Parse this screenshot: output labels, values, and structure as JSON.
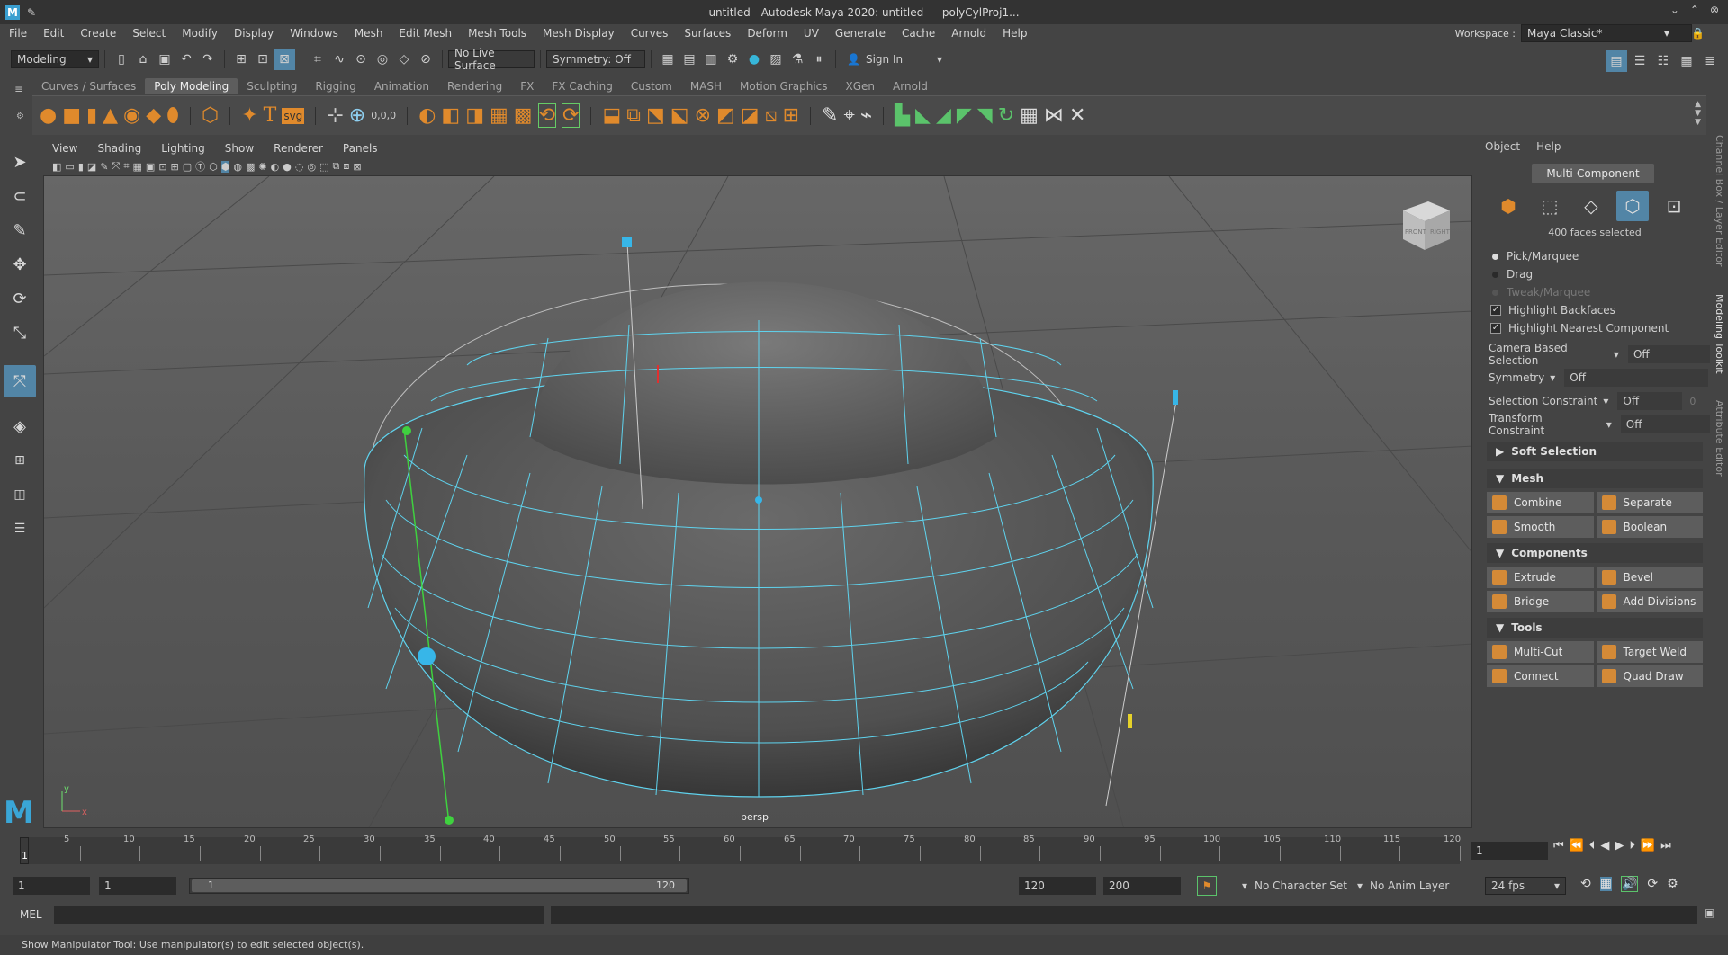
{
  "window": {
    "title": "untitled - Autodesk Maya 2020: untitled  ---  polyCylProj1...",
    "app_logo": "M"
  },
  "menubar": [
    "File",
    "Edit",
    "Create",
    "Select",
    "Modify",
    "Display",
    "Windows",
    "Mesh",
    "Edit Mesh",
    "Mesh Tools",
    "Mesh Display",
    "Curves",
    "Surfaces",
    "Deform",
    "UV",
    "Generate",
    "Cache",
    "Arnold",
    "Help"
  ],
  "workspace": {
    "label": "Workspace :",
    "value": "Maya Classic*"
  },
  "statusline": {
    "mode": "Modeling",
    "live_surface": "No Live Surface",
    "symmetry": "Symmetry: Off",
    "sign_in": "Sign In"
  },
  "shelf_tabs": [
    "Curves / Surfaces",
    "Poly Modeling",
    "Sculpting",
    "Rigging",
    "Animation",
    "Rendering",
    "FX",
    "FX Caching",
    "Custom",
    "MASH",
    "Motion Graphics",
    "XGen",
    "Arnold"
  ],
  "shelf_active": "Poly Modeling",
  "shelf_icons": [
    "sphere-icon",
    "cube-icon",
    "cylinder-icon",
    "cone-icon",
    "torus-icon",
    "plane-icon",
    "disc-icon",
    "platonic-icon",
    "star-icon",
    "text-icon",
    "svg-icon",
    "combine-icon",
    "separate-icon",
    "smooth-icon",
    "boolean-icon",
    "extrude-icon",
    "bevel-icon",
    "bridge-icon"
  ],
  "shelf_text_icons": {
    "text": "T",
    "svg": "svg",
    "coords": "0,0,0"
  },
  "panel_menu": [
    "View",
    "Shading",
    "Lighting",
    "Show",
    "Renderer",
    "Panels"
  ],
  "viewport": {
    "camera": "persp",
    "viewcube_front": "FRONT",
    "viewcube_right": "RIGHT",
    "axis_y": "y",
    "axis_x": "x"
  },
  "modeling_toolkit": {
    "tabs": [
      "Object",
      "Help"
    ],
    "multi_component": "Multi-Component",
    "selection_count": "400 faces selected",
    "modes": [
      "Pick/Marquee",
      "Drag",
      "Tweak/Marquee"
    ],
    "checks": [
      "Highlight Backfaces",
      "Highlight Nearest Component"
    ],
    "props": [
      {
        "label": "Camera Based Selection",
        "value": "Off"
      },
      {
        "label": "Symmetry",
        "value": "Off"
      },
      {
        "label": "Selection Constraint",
        "value": "Off",
        "extra": "0"
      },
      {
        "label": "Transform Constraint",
        "value": "Off"
      }
    ],
    "soft_selection": "Soft Selection",
    "sections": [
      {
        "title": "Mesh",
        "buttons": [
          "Combine",
          "Separate",
          "Smooth",
          "Boolean"
        ]
      },
      {
        "title": "Components",
        "buttons": [
          "Extrude",
          "Bevel",
          "Bridge",
          "Add Divisions"
        ]
      },
      {
        "title": "Tools",
        "buttons": [
          "Multi-Cut",
          "Target Weld",
          "Connect",
          "Quad Draw"
        ]
      }
    ]
  },
  "side_tabs": [
    "Channel Box / Layer Editor",
    "Modeling Toolkit",
    "Attribute Editor"
  ],
  "timeline": {
    "ticks": [
      "5",
      "10",
      "15",
      "20",
      "25",
      "30",
      "35",
      "40",
      "45",
      "50",
      "55",
      "60",
      "65",
      "70",
      "75",
      "80",
      "85",
      "90",
      "95",
      "100",
      "105",
      "110",
      "115",
      "120"
    ],
    "current_frame_marker": "1",
    "current_frame": "1"
  },
  "range": {
    "start": "1",
    "playback_start": "1",
    "slider_start": "1",
    "slider_end": "120",
    "playback_end": "120",
    "end": "200",
    "character_set": "No Character Set",
    "anim_layer": "No Anim Layer",
    "fps": "24 fps"
  },
  "command_line": {
    "label": "MEL"
  },
  "help_line": "Show Manipulator Tool: Use manipulator(s) to edit selected object(s).",
  "colors": {
    "accent": "#5285a6",
    "wire": "#5fd3ee",
    "shelf_orange": "#e08a2c"
  }
}
